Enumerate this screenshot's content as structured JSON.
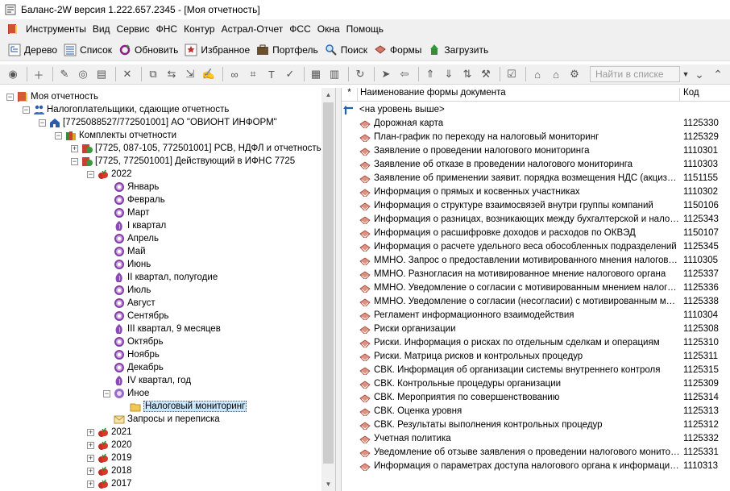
{
  "window": {
    "title": "Баланс-2W  версия 1.222.657.2345 - [Моя отчетность]"
  },
  "menu": [
    {
      "label": "Инструменты"
    },
    {
      "label": "Вид"
    },
    {
      "label": "Сервис"
    },
    {
      "label": "ФНС"
    },
    {
      "label": "Контур"
    },
    {
      "label": "Астрал-Отчет"
    },
    {
      "label": "ФСС"
    },
    {
      "label": "Окна"
    },
    {
      "label": "Помощь"
    }
  ],
  "toolbar": [
    {
      "label": "Дерево",
      "icon": "tree-icon"
    },
    {
      "label": "Список",
      "icon": "list-icon"
    },
    {
      "label": "Обновить",
      "icon": "refresh-icon"
    },
    {
      "label": "Избранное",
      "icon": "favorites-icon"
    },
    {
      "label": "Портфель",
      "icon": "briefcase-icon"
    },
    {
      "label": "Поиск",
      "icon": "search-icon"
    },
    {
      "label": "Формы",
      "icon": "forms-icon"
    },
    {
      "label": "Загрузить",
      "icon": "load-icon"
    }
  ],
  "find": {
    "placeholder": "Найти в списке"
  },
  "tree": [
    {
      "label": "Моя отчетность",
      "level": 0,
      "exp": "-",
      "icon": "book-icon"
    },
    {
      "label": "Налогоплательщики, сдающие отчетность",
      "level": 1,
      "exp": "-",
      "icon": "people-icon"
    },
    {
      "label": "[7725088527/772501001] АО \"ОВИОНТ ИНФОРМ\"",
      "level": 2,
      "exp": "-",
      "icon": "house-icon"
    },
    {
      "label": "Комплекты отчетности",
      "level": 3,
      "exp": "-",
      "icon": "books-icon"
    },
    {
      "label": "[7725, 087-105, 772501001] РСВ, НДФЛ и отчетность в Г",
      "level": 4,
      "exp": "+",
      "icon": "kit-icon"
    },
    {
      "label": "[7725, 772501001] Действующий в ИФНС 7725",
      "level": 4,
      "exp": "-",
      "icon": "kit-icon"
    },
    {
      "label": "2022",
      "level": 5,
      "exp": "-",
      "icon": "year-icon"
    },
    {
      "label": "Январь",
      "level": 6,
      "icon": "month-icon"
    },
    {
      "label": "Февраль",
      "level": 6,
      "icon": "month-icon"
    },
    {
      "label": "Март",
      "level": 6,
      "icon": "month-icon"
    },
    {
      "label": "I квартал",
      "level": 6,
      "icon": "quarter-icon"
    },
    {
      "label": "Апрель",
      "level": 6,
      "icon": "month-icon"
    },
    {
      "label": "Май",
      "level": 6,
      "icon": "month-icon"
    },
    {
      "label": "Июнь",
      "level": 6,
      "icon": "month-icon"
    },
    {
      "label": "II квартал, полугодие",
      "level": 6,
      "icon": "quarter-icon"
    },
    {
      "label": "Июль",
      "level": 6,
      "icon": "month-icon"
    },
    {
      "label": "Август",
      "level": 6,
      "icon": "month-icon"
    },
    {
      "label": "Сентябрь",
      "level": 6,
      "icon": "month-icon"
    },
    {
      "label": "III квартал, 9 месяцев",
      "level": 6,
      "icon": "quarter-icon"
    },
    {
      "label": "Октябрь",
      "level": 6,
      "icon": "month-icon"
    },
    {
      "label": "Ноябрь",
      "level": 6,
      "icon": "month-icon"
    },
    {
      "label": "Декабрь",
      "level": 6,
      "icon": "month-icon"
    },
    {
      "label": "IV квартал, год",
      "level": 6,
      "icon": "quarter-icon"
    },
    {
      "label": "Иное",
      "level": 6,
      "exp": "-",
      "icon": "other-icon"
    },
    {
      "label": "Налоговый мониторинг",
      "level": 7,
      "icon": "folder-icon",
      "selected": true
    },
    {
      "label": "Запросы и переписка",
      "level": 6,
      "icon": "envelope-icon"
    },
    {
      "label": "2021",
      "level": 5,
      "exp": "+",
      "icon": "year-icon"
    },
    {
      "label": "2020",
      "level": 5,
      "exp": "+",
      "icon": "year-icon"
    },
    {
      "label": "2019",
      "level": 5,
      "exp": "+",
      "icon": "year-icon"
    },
    {
      "label": "2018",
      "level": 5,
      "exp": "+",
      "icon": "year-icon"
    },
    {
      "label": "2017",
      "level": 5,
      "exp": "+",
      "icon": "year-icon"
    }
  ],
  "grid": {
    "headers": {
      "star": "*",
      "name": "Наименование формы документа",
      "code": "Код"
    },
    "up": "<на уровень выше>",
    "rows": [
      {
        "name": "Дорожная карта",
        "code": "1125330"
      },
      {
        "name": "План-график по переходу на налоговый мониторинг",
        "code": "1125329"
      },
      {
        "name": "Заявление о проведении налогового мониторинга",
        "code": "1110301"
      },
      {
        "name": "Заявление об отказе в проведении налогового мониторинга",
        "code": "1110303"
      },
      {
        "name": "Заявление об применении заявит. порядка возмещения НДС (акциза) п...",
        "code": "1151155"
      },
      {
        "name": "Информация о прямых и косвенных участниках",
        "code": "1110302"
      },
      {
        "name": "Информация о структуре взаимосвязей внутри группы компаний",
        "code": "1150106"
      },
      {
        "name": "Информация о разницах, возникающих между бухгалтерской и налого...",
        "code": "1125343"
      },
      {
        "name": "Информация о расшифровке доходов и расходов по ОКВЭД",
        "code": "1150107"
      },
      {
        "name": "Информация о расчете удельного веса обособленных подразделений",
        "code": "1125345"
      },
      {
        "name": "ММНО. Запрос о предоставлении мотивированного мнения налогового...",
        "code": "1110305"
      },
      {
        "name": "ММНО. Разногласия на мотивированное мнение налогового органа",
        "code": "1125337"
      },
      {
        "name": "ММНО. Уведомление о согласии с мотивированным мнением налогов...",
        "code": "1125336"
      },
      {
        "name": "ММНО. Уведомление о согласии (несогласии) с мотивированным мне...",
        "code": "1125338"
      },
      {
        "name": "Регламент информационного взаимодействия",
        "code": "1110304"
      },
      {
        "name": "Риски организации",
        "code": "1125308"
      },
      {
        "name": "Риски. Информация о рисках по отдельным сделкам и операциям",
        "code": "1125310"
      },
      {
        "name": "Риски. Матрица рисков и контрольных процедур",
        "code": "1125311"
      },
      {
        "name": "СВК. Информация об организации системы внутреннего контроля",
        "code": "1125315"
      },
      {
        "name": "СВК. Контрольные процедуры организации",
        "code": "1125309"
      },
      {
        "name": "СВК. Мероприятия по совершенствованию",
        "code": "1125314"
      },
      {
        "name": "СВК. Оценка уровня",
        "code": "1125313"
      },
      {
        "name": "СВК. Результаты выполнения контрольных процедур",
        "code": "1125312"
      },
      {
        "name": "Учетная политика",
        "code": "1125332"
      },
      {
        "name": "Уведомление об отзыве заявления о проведении налогового монитор...",
        "code": "1125331"
      },
      {
        "name": "Информация о параметрах доступа налогового органа к информацион...",
        "code": "1110313"
      }
    ]
  }
}
